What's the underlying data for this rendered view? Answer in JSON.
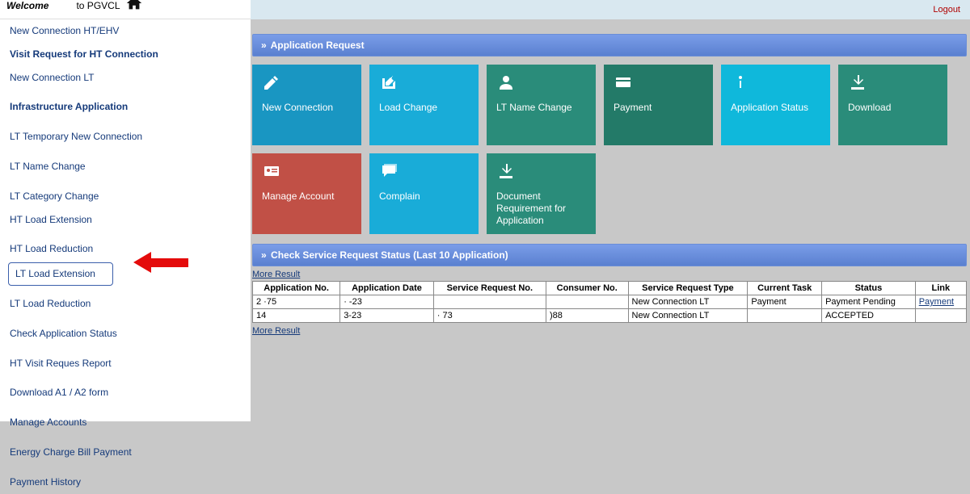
{
  "topbar": {
    "logout": "Logout"
  },
  "welcome": {
    "prefix": "Welcome",
    "suffix": " to PGVCL"
  },
  "sidebar": {
    "items": [
      {
        "label": "New Connection HT/EHV",
        "bold": false
      },
      {
        "label": "Visit Request for HT Connection",
        "bold": true
      },
      {
        "label": "New Connection LT",
        "bold": false
      },
      {
        "label": "Infrastructure Application",
        "bold": true,
        "spacer": true
      },
      {
        "label": "LT Temporary New Connection",
        "bold": false,
        "spacer": true
      },
      {
        "label": "LT Name Change",
        "bold": false,
        "spacer": true
      },
      {
        "label": "LT Category Change",
        "bold": false,
        "spacer": true
      },
      {
        "label": "HT Load Extension",
        "bold": false
      },
      {
        "label": "HT Load Reduction",
        "bold": false,
        "spacer": true
      },
      {
        "label": "LT Load Extension",
        "bold": false,
        "boxed": true
      },
      {
        "label": "LT Load Reduction",
        "bold": false,
        "spacer": true
      },
      {
        "label": "Check Application Status",
        "bold": false,
        "spacer": true
      },
      {
        "label": "HT Visit Reques Report",
        "bold": false,
        "spacer": true
      },
      {
        "label": "Download A1 / A2 form",
        "bold": false,
        "spacer": true
      },
      {
        "label": "Manage Accounts",
        "bold": false,
        "spacer": true
      },
      {
        "label": "Energy Charge Bill Payment",
        "bold": false,
        "spacer": true
      },
      {
        "label": "Payment History",
        "bold": false,
        "spacer": true
      }
    ]
  },
  "sections": {
    "app_req": "Application Request",
    "status": "Check Service Request Status (Last 10 Application)"
  },
  "tiles": [
    {
      "label": "New Connection",
      "color": "bg-blue1",
      "icon": "pencil"
    },
    {
      "label": "Load Change",
      "color": "bg-blue2",
      "icon": "edit"
    },
    {
      "label": "LT Name Change",
      "color": "bg-teal",
      "icon": "user"
    },
    {
      "label": "Payment",
      "color": "bg-green",
      "icon": "card"
    },
    {
      "label": "Application Status",
      "color": "bg-cyan",
      "icon": "info"
    },
    {
      "label": "Download",
      "color": "bg-teal",
      "icon": "download"
    },
    {
      "label": "Manage Account",
      "color": "bg-red",
      "icon": "idcard"
    },
    {
      "label": "Complain",
      "color": "bg-blue2",
      "icon": "chat"
    },
    {
      "label": "Document Requirement for Application",
      "color": "bg-teal",
      "icon": "download"
    }
  ],
  "more_result": "More Result",
  "table": {
    "headers": [
      "Application No.",
      "Application Date",
      "Service Request No.",
      "Consumer No.",
      "Service Request Type",
      "Current Task",
      "Status",
      "Link"
    ],
    "rows": [
      {
        "appno": "2    ·75",
        "date": "·    -23",
        "srno": "",
        "consno": "",
        "type": "New Connection LT",
        "task": "Payment",
        "status": "Payment Pending",
        "link": "Payment"
      },
      {
        "appno": "      14",
        "date": "    3-23",
        "srno": "·     73",
        "consno": "        )88",
        "type": "New Connection LT",
        "task": "",
        "status": "ACCEPTED",
        "link": ""
      }
    ]
  }
}
